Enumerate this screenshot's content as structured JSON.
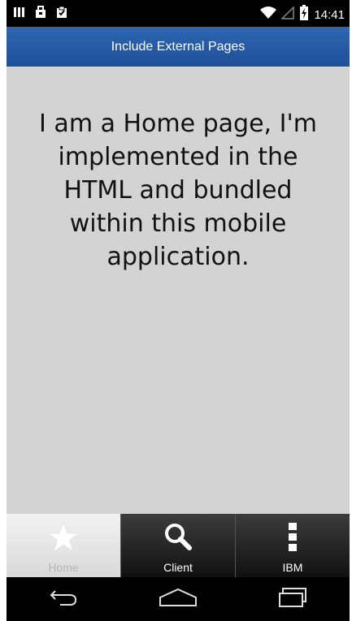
{
  "status_bar": {
    "time": "14:41",
    "left_icons": [
      "signal-bars-icon",
      "bag-icon",
      "clipboard-check-icon"
    ],
    "right_icons": [
      "wifi-icon",
      "cell-signal-icon",
      "battery-charging-icon"
    ]
  },
  "header": {
    "title": "Include External Pages"
  },
  "content": {
    "message": "I am a Home page, I'm implemented in the HTML and bundled within this mobile application."
  },
  "tabs": [
    {
      "label": "Home",
      "icon": "star-icon",
      "active": true
    },
    {
      "label": "Client",
      "icon": "search-icon",
      "active": false
    },
    {
      "label": "IBM",
      "icon": "more-vertical-icon",
      "active": false
    }
  ],
  "nav_bar": {
    "buttons": [
      "back-icon",
      "home-icon",
      "recent-apps-icon"
    ]
  },
  "colors": {
    "header_bg": "#2a5ca8",
    "content_bg": "#d3d3d3",
    "tab_active_bg": "#e8e8e8",
    "tab_inactive_bg": "#222222"
  }
}
